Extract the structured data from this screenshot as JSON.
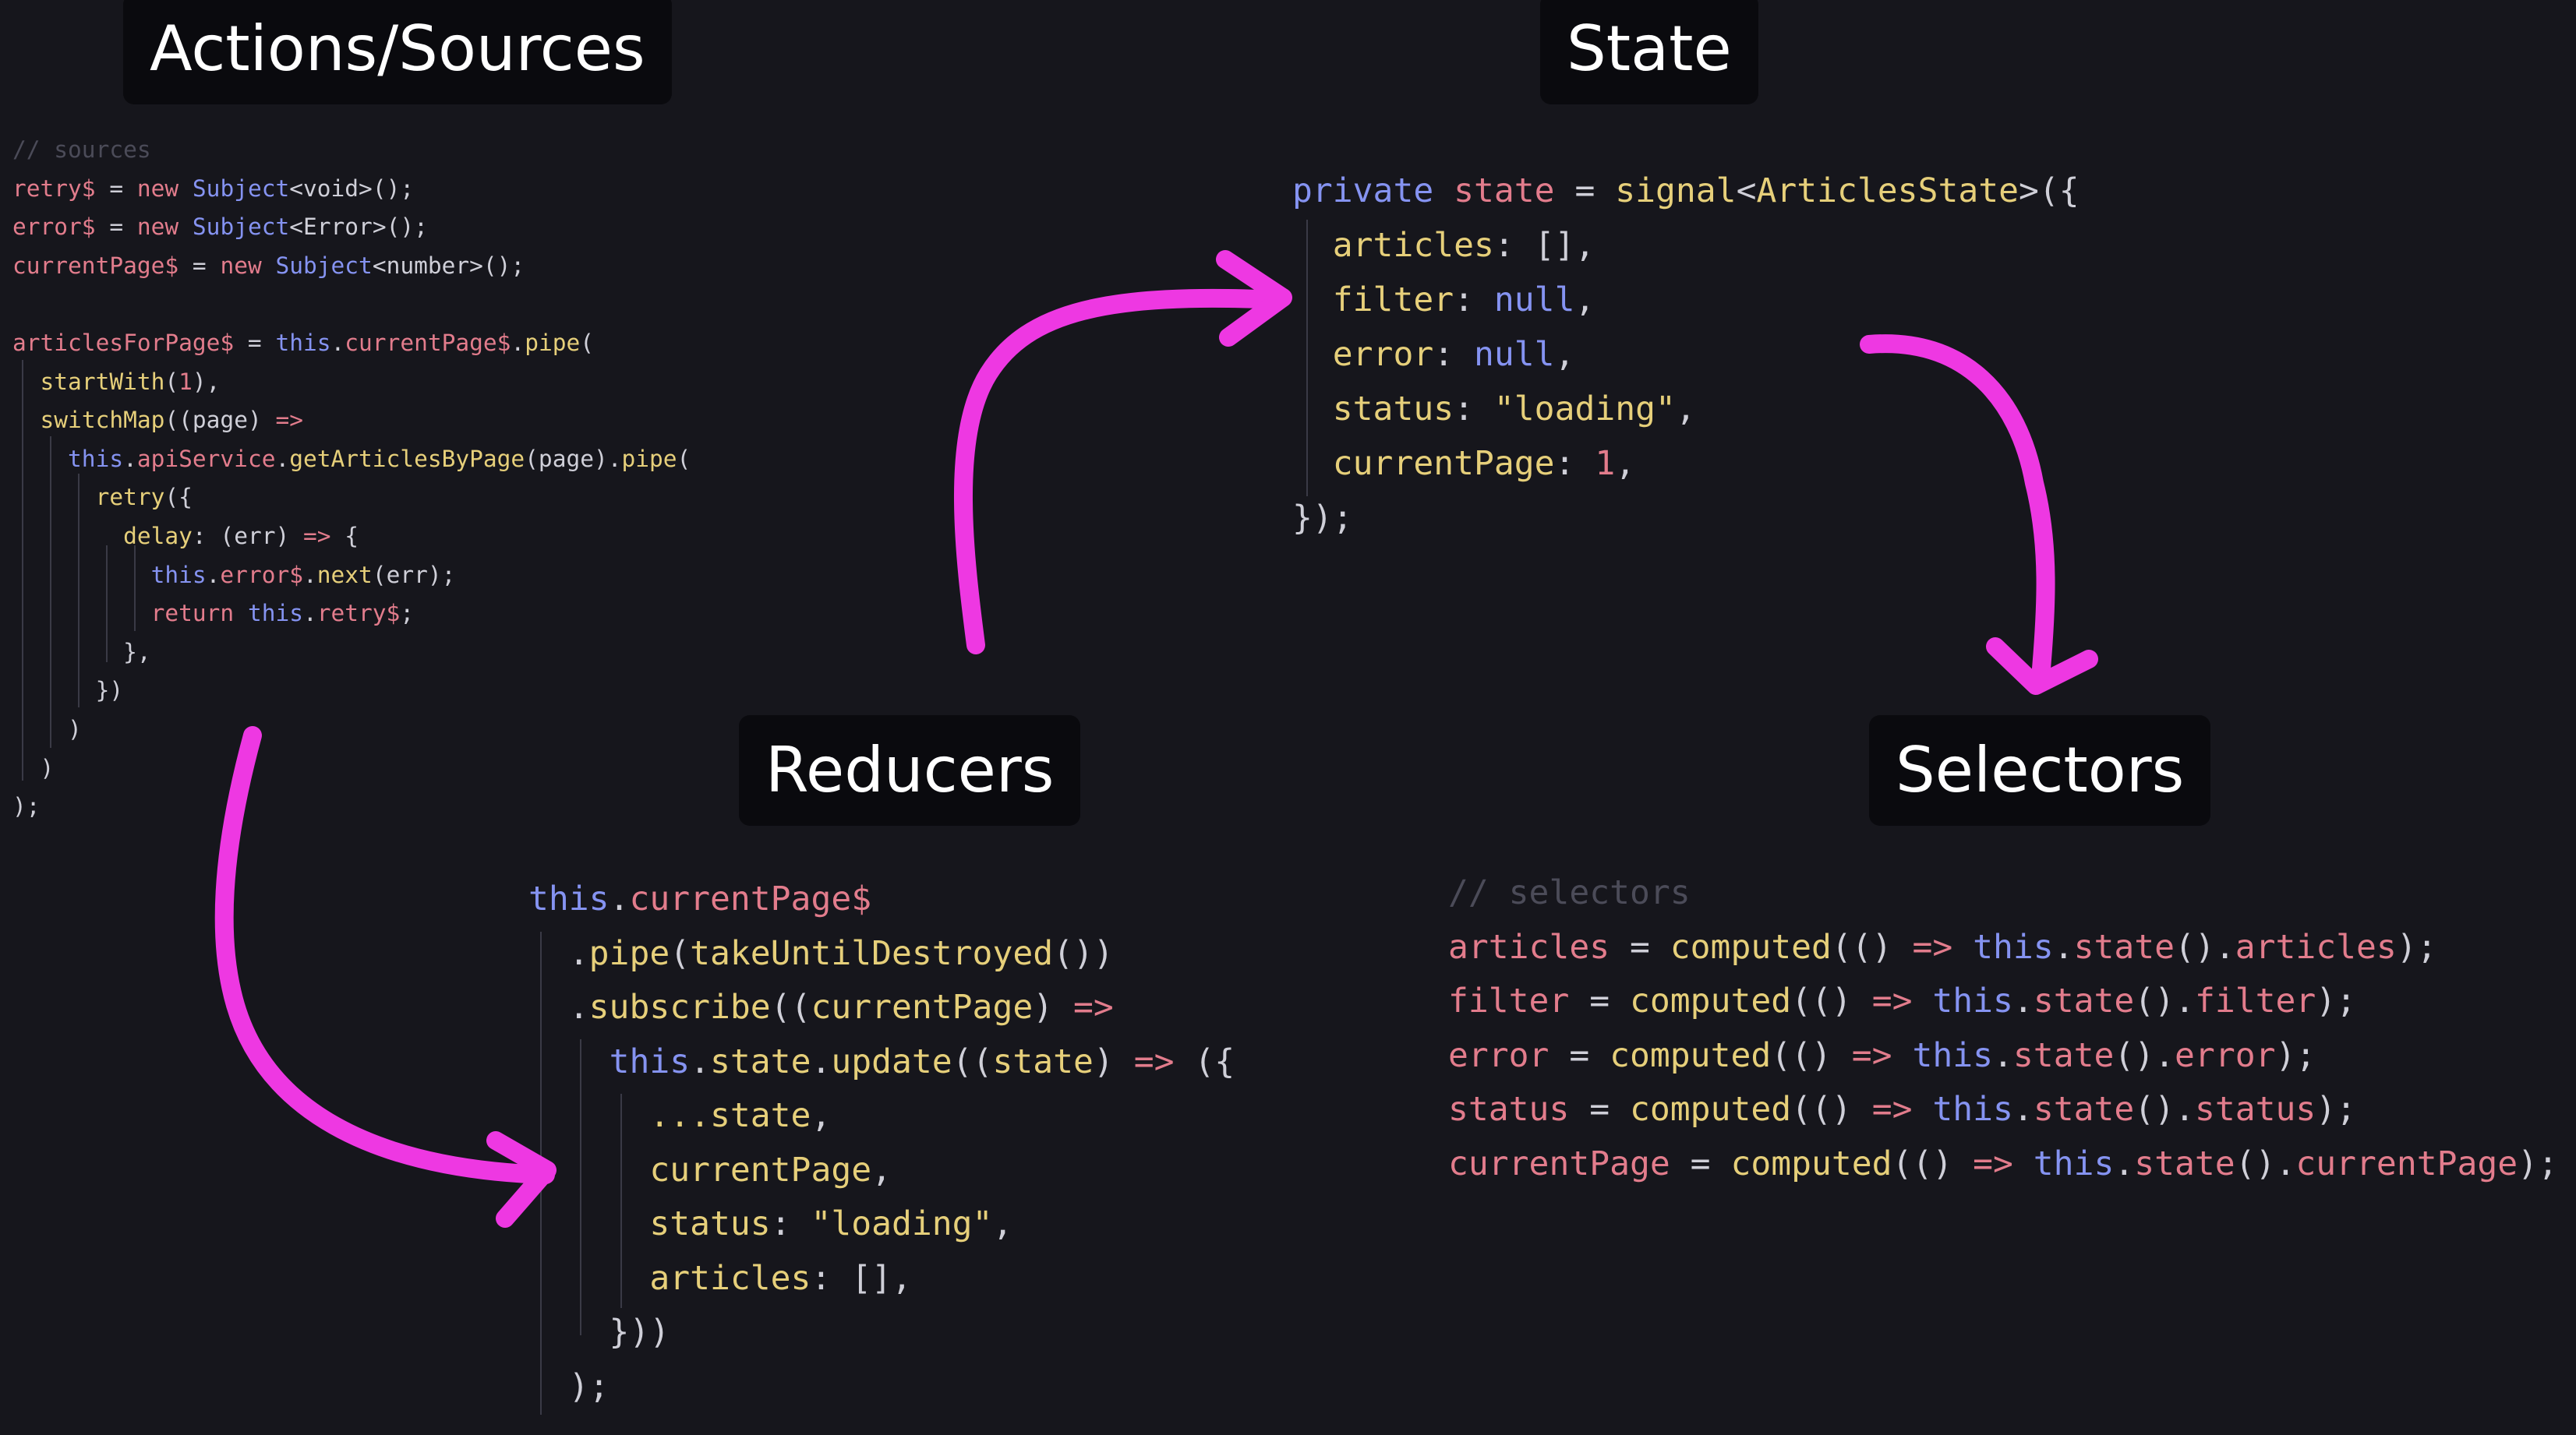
{
  "sections": {
    "actions": "Actions/Sources",
    "state": "State",
    "reducers": "Reducers",
    "selectors": "Selectors"
  },
  "colors": {
    "background": "#16161c",
    "title_bg": "#0a0a0e",
    "arrow": "#ee38e2",
    "identifier": "#e27c8c",
    "keyword": "#8593f1",
    "function": "#e6cf7a",
    "comment": "#4b4b58"
  },
  "code": {
    "actions": [
      [
        {
          "t": "// sources",
          "c": "com"
        }
      ],
      [
        {
          "t": "retry$",
          "c": "key"
        },
        {
          "t": " = ",
          "c": "punc"
        },
        {
          "t": "new ",
          "c": "rest"
        },
        {
          "t": "Subject",
          "c": "kw"
        },
        {
          "t": "<void>();",
          "c": "punc"
        }
      ],
      [
        {
          "t": "error$",
          "c": "key"
        },
        {
          "t": " = ",
          "c": "punc"
        },
        {
          "t": "new ",
          "c": "rest"
        },
        {
          "t": "Subject",
          "c": "kw"
        },
        {
          "t": "<Error>();",
          "c": "punc"
        }
      ],
      [
        {
          "t": "currentPage$",
          "c": "key"
        },
        {
          "t": " = ",
          "c": "punc"
        },
        {
          "t": "new ",
          "c": "rest"
        },
        {
          "t": "Subject",
          "c": "kw"
        },
        {
          "t": "<number>();",
          "c": "punc"
        }
      ],
      [],
      [
        {
          "t": "articlesForPage$",
          "c": "key"
        },
        {
          "t": " = ",
          "c": "punc"
        },
        {
          "t": "this",
          "c": "kw"
        },
        {
          "t": ".",
          "c": "punc"
        },
        {
          "t": "currentPage$",
          "c": "key"
        },
        {
          "t": ".",
          "c": "punc"
        },
        {
          "t": "pipe",
          "c": "fn"
        },
        {
          "t": "(",
          "c": "punc"
        }
      ],
      [
        {
          "t": "  ",
          "c": "punc"
        },
        {
          "t": "startWith",
          "c": "fn"
        },
        {
          "t": "(",
          "c": "punc"
        },
        {
          "t": "1",
          "c": "num"
        },
        {
          "t": "),",
          "c": "punc"
        }
      ],
      [
        {
          "t": "  ",
          "c": "punc"
        },
        {
          "t": "switchMap",
          "c": "fn"
        },
        {
          "t": "((page) ",
          "c": "punc"
        },
        {
          "t": "=>",
          "c": "rest"
        }
      ],
      [
        {
          "t": "    ",
          "c": "punc"
        },
        {
          "t": "this",
          "c": "kw"
        },
        {
          "t": ".",
          "c": "punc"
        },
        {
          "t": "apiService",
          "c": "key"
        },
        {
          "t": ".",
          "c": "punc"
        },
        {
          "t": "getArticlesByPage",
          "c": "fn"
        },
        {
          "t": "(page).",
          "c": "punc"
        },
        {
          "t": "pipe",
          "c": "fn"
        },
        {
          "t": "(",
          "c": "punc"
        }
      ],
      [
        {
          "t": "      ",
          "c": "punc"
        },
        {
          "t": "retry",
          "c": "fn"
        },
        {
          "t": "({",
          "c": "punc"
        }
      ],
      [
        {
          "t": "        ",
          "c": "punc"
        },
        {
          "t": "delay",
          "c": "fn"
        },
        {
          "t": ": (err) ",
          "c": "punc"
        },
        {
          "t": "=>",
          "c": "rest"
        },
        {
          "t": " {",
          "c": "punc"
        }
      ],
      [
        {
          "t": "          ",
          "c": "punc"
        },
        {
          "t": "this",
          "c": "kw"
        },
        {
          "t": ".",
          "c": "punc"
        },
        {
          "t": "error$",
          "c": "key"
        },
        {
          "t": ".",
          "c": "punc"
        },
        {
          "t": "next",
          "c": "fn"
        },
        {
          "t": "(err);",
          "c": "punc"
        }
      ],
      [
        {
          "t": "          ",
          "c": "punc"
        },
        {
          "t": "return ",
          "c": "rest"
        },
        {
          "t": "this",
          "c": "kw"
        },
        {
          "t": ".",
          "c": "punc"
        },
        {
          "t": "retry$",
          "c": "key"
        },
        {
          "t": ";",
          "c": "punc"
        }
      ],
      [
        {
          "t": "        },",
          "c": "punc"
        }
      ],
      [
        {
          "t": "      })",
          "c": "punc"
        }
      ],
      [
        {
          "t": "    )",
          "c": "punc"
        }
      ],
      [
        {
          "t": "  )",
          "c": "punc"
        }
      ],
      [
        {
          "t": ");",
          "c": "punc"
        }
      ]
    ],
    "state": [
      [
        {
          "t": "private ",
          "c": "kw"
        },
        {
          "t": "state",
          "c": "key"
        },
        {
          "t": " = ",
          "c": "punc"
        },
        {
          "t": "signal",
          "c": "fn"
        },
        {
          "t": "<",
          "c": "punc"
        },
        {
          "t": "ArticlesState",
          "c": "fn"
        },
        {
          "t": ">({",
          "c": "punc"
        }
      ],
      [
        {
          "t": "  ",
          "c": "punc"
        },
        {
          "t": "articles",
          "c": "fn"
        },
        {
          "t": ": [],",
          "c": "punc"
        }
      ],
      [
        {
          "t": "  ",
          "c": "punc"
        },
        {
          "t": "filter",
          "c": "fn"
        },
        {
          "t": ": ",
          "c": "punc"
        },
        {
          "t": "null",
          "c": "kw"
        },
        {
          "t": ",",
          "c": "punc"
        }
      ],
      [
        {
          "t": "  ",
          "c": "punc"
        },
        {
          "t": "error",
          "c": "fn"
        },
        {
          "t": ": ",
          "c": "punc"
        },
        {
          "t": "null",
          "c": "kw"
        },
        {
          "t": ",",
          "c": "punc"
        }
      ],
      [
        {
          "t": "  ",
          "c": "punc"
        },
        {
          "t": "status",
          "c": "fn"
        },
        {
          "t": ": ",
          "c": "punc"
        },
        {
          "t": "\"loading\"",
          "c": "str"
        },
        {
          "t": ",",
          "c": "punc"
        }
      ],
      [
        {
          "t": "  ",
          "c": "punc"
        },
        {
          "t": "currentPage",
          "c": "fn"
        },
        {
          "t": ": ",
          "c": "punc"
        },
        {
          "t": "1",
          "c": "num"
        },
        {
          "t": ",",
          "c": "punc"
        }
      ],
      [
        {
          "t": "});",
          "c": "punc"
        }
      ]
    ],
    "reducer": [
      [
        {
          "t": "this",
          "c": "kw"
        },
        {
          "t": ".",
          "c": "punc"
        },
        {
          "t": "currentPage$",
          "c": "key"
        }
      ],
      [
        {
          "t": "  .",
          "c": "punc"
        },
        {
          "t": "pipe",
          "c": "fn"
        },
        {
          "t": "(",
          "c": "punc"
        },
        {
          "t": "takeUntilDestroyed",
          "c": "fn"
        },
        {
          "t": "())",
          "c": "punc"
        }
      ],
      [
        {
          "t": "  .",
          "c": "punc"
        },
        {
          "t": "subscribe",
          "c": "fn"
        },
        {
          "t": "((",
          "c": "punc"
        },
        {
          "t": "currentPage",
          "c": "fn"
        },
        {
          "t": ") ",
          "c": "punc"
        },
        {
          "t": "=>",
          "c": "rest"
        }
      ],
      [
        {
          "t": "    ",
          "c": "punc"
        },
        {
          "t": "this",
          "c": "kw"
        },
        {
          "t": ".",
          "c": "punc"
        },
        {
          "t": "state",
          "c": "fn"
        },
        {
          "t": ".",
          "c": "punc"
        },
        {
          "t": "update",
          "c": "fn"
        },
        {
          "t": "((",
          "c": "punc"
        },
        {
          "t": "state",
          "c": "fn"
        },
        {
          "t": ") ",
          "c": "punc"
        },
        {
          "t": "=>",
          "c": "rest"
        },
        {
          "t": " ({",
          "c": "punc"
        }
      ],
      [
        {
          "t": "      ",
          "c": "punc"
        },
        {
          "t": "...state",
          "c": "fn"
        },
        {
          "t": ",",
          "c": "punc"
        }
      ],
      [
        {
          "t": "      ",
          "c": "punc"
        },
        {
          "t": "currentPage",
          "c": "fn"
        },
        {
          "t": ",",
          "c": "punc"
        }
      ],
      [
        {
          "t": "      ",
          "c": "punc"
        },
        {
          "t": "status",
          "c": "fn"
        },
        {
          "t": ": ",
          "c": "punc"
        },
        {
          "t": "\"loading\"",
          "c": "str"
        },
        {
          "t": ",",
          "c": "punc"
        }
      ],
      [
        {
          "t": "      ",
          "c": "punc"
        },
        {
          "t": "articles",
          "c": "fn"
        },
        {
          "t": ": [],",
          "c": "punc"
        }
      ],
      [
        {
          "t": "    }))",
          "c": "punc"
        }
      ],
      [
        {
          "t": "  );",
          "c": "punc"
        }
      ]
    ],
    "selectors": [
      [
        {
          "t": "// selectors",
          "c": "com"
        }
      ],
      [
        {
          "t": "articles",
          "c": "key"
        },
        {
          "t": " = ",
          "c": "punc"
        },
        {
          "t": "computed",
          "c": "fn"
        },
        {
          "t": "(() ",
          "c": "punc"
        },
        {
          "t": "=>",
          "c": "rest"
        },
        {
          "t": " ",
          "c": "punc"
        },
        {
          "t": "this",
          "c": "kw"
        },
        {
          "t": ".",
          "c": "punc"
        },
        {
          "t": "state",
          "c": "key"
        },
        {
          "t": "().",
          "c": "punc"
        },
        {
          "t": "articles",
          "c": "key"
        },
        {
          "t": ");",
          "c": "punc"
        }
      ],
      [
        {
          "t": "filter",
          "c": "key"
        },
        {
          "t": " = ",
          "c": "punc"
        },
        {
          "t": "computed",
          "c": "fn"
        },
        {
          "t": "(() ",
          "c": "punc"
        },
        {
          "t": "=>",
          "c": "rest"
        },
        {
          "t": " ",
          "c": "punc"
        },
        {
          "t": "this",
          "c": "kw"
        },
        {
          "t": ".",
          "c": "punc"
        },
        {
          "t": "state",
          "c": "key"
        },
        {
          "t": "().",
          "c": "punc"
        },
        {
          "t": "filter",
          "c": "key"
        },
        {
          "t": ");",
          "c": "punc"
        }
      ],
      [
        {
          "t": "error",
          "c": "key"
        },
        {
          "t": " = ",
          "c": "punc"
        },
        {
          "t": "computed",
          "c": "fn"
        },
        {
          "t": "(() ",
          "c": "punc"
        },
        {
          "t": "=>",
          "c": "rest"
        },
        {
          "t": " ",
          "c": "punc"
        },
        {
          "t": "this",
          "c": "kw"
        },
        {
          "t": ".",
          "c": "punc"
        },
        {
          "t": "state",
          "c": "key"
        },
        {
          "t": "().",
          "c": "punc"
        },
        {
          "t": "error",
          "c": "key"
        },
        {
          "t": ");",
          "c": "punc"
        }
      ],
      [
        {
          "t": "status",
          "c": "key"
        },
        {
          "t": " = ",
          "c": "punc"
        },
        {
          "t": "computed",
          "c": "fn"
        },
        {
          "t": "(() ",
          "c": "punc"
        },
        {
          "t": "=>",
          "c": "rest"
        },
        {
          "t": " ",
          "c": "punc"
        },
        {
          "t": "this",
          "c": "kw"
        },
        {
          "t": ".",
          "c": "punc"
        },
        {
          "t": "state",
          "c": "key"
        },
        {
          "t": "().",
          "c": "punc"
        },
        {
          "t": "status",
          "c": "key"
        },
        {
          "t": ");",
          "c": "punc"
        }
      ],
      [
        {
          "t": "currentPage",
          "c": "key"
        },
        {
          "t": " = ",
          "c": "punc"
        },
        {
          "t": "computed",
          "c": "fn"
        },
        {
          "t": "(() ",
          "c": "punc"
        },
        {
          "t": "=>",
          "c": "rest"
        },
        {
          "t": " ",
          "c": "punc"
        },
        {
          "t": "this",
          "c": "kw"
        },
        {
          "t": ".",
          "c": "punc"
        },
        {
          "t": "state",
          "c": "key"
        },
        {
          "t": "().",
          "c": "punc"
        },
        {
          "t": "currentPage",
          "c": "key"
        },
        {
          "t": ");",
          "c": "punc"
        }
      ]
    ]
  }
}
